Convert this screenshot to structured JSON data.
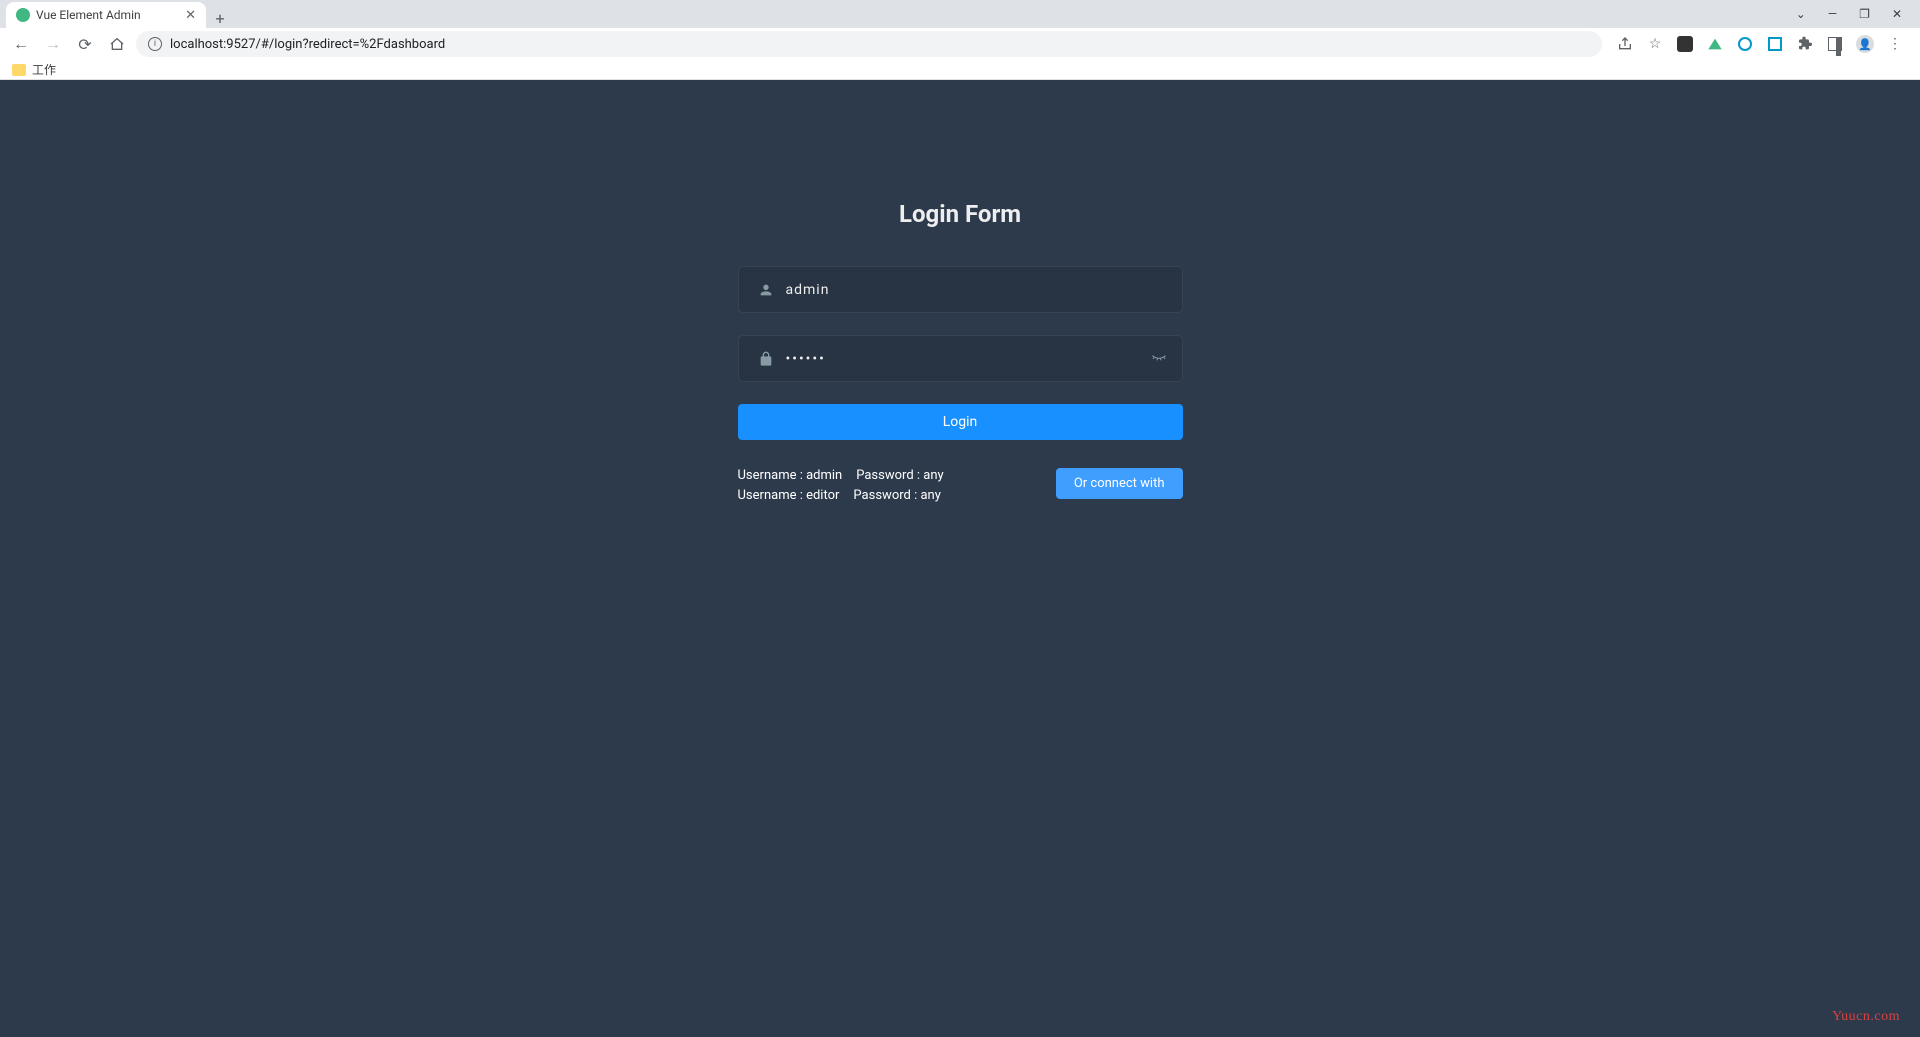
{
  "browser": {
    "tab_title": "Vue Element Admin",
    "url": "localhost:9527/#/login?redirect=%2Fdashboard",
    "bookmark_label": "工作"
  },
  "login": {
    "title": "Login Form",
    "username_value": "admin",
    "password_value": "••••••",
    "login_button": "Login",
    "connect_button": "Or connect with",
    "tips": {
      "line1_user": "Username : admin",
      "line1_pass": "Password : any",
      "line2_user": "Username : editor",
      "line2_pass": "Password : any"
    }
  },
  "watermark": "Yuucn.com"
}
